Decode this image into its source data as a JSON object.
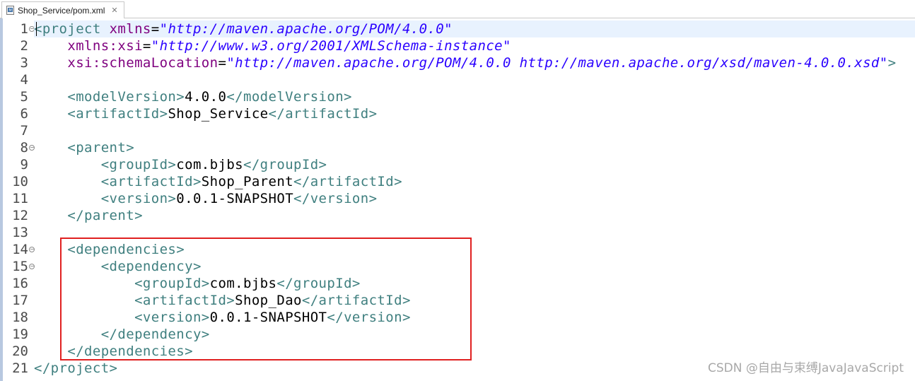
{
  "tab": {
    "title": "Shop_Service/pom.xml",
    "icon": "xml-file-icon",
    "close": "✕"
  },
  "lines": [
    {
      "n": "1",
      "fold": true,
      "parts": [
        [
          "tag",
          "<project "
        ],
        [
          "attr",
          "xmlns"
        ],
        [
          "eq",
          "="
        ],
        [
          "str",
          "\"http://maven.apache.org/POM/4.0.0\""
        ]
      ]
    },
    {
      "n": "2",
      "fold": false,
      "parts": [
        [
          "txt",
          "    "
        ],
        [
          "attr",
          "xmlns:xsi"
        ],
        [
          "eq",
          "="
        ],
        [
          "str",
          "\"http://www.w3.org/2001/XMLSchema-instance\""
        ]
      ]
    },
    {
      "n": "3",
      "fold": false,
      "parts": [
        [
          "txt",
          "    "
        ],
        [
          "attr",
          "xsi:schemaLocation"
        ],
        [
          "eq",
          "="
        ],
        [
          "str",
          "\"http://maven.apache.org/POM/4.0.0 http://maven.apache.org/xsd/maven-4.0.0.xsd\""
        ],
        [
          "tag",
          ">"
        ]
      ]
    },
    {
      "n": "4",
      "fold": false,
      "parts": []
    },
    {
      "n": "5",
      "fold": false,
      "parts": [
        [
          "txt",
          "    "
        ],
        [
          "tag",
          "<modelVersion>"
        ],
        [
          "txt",
          "4.0.0"
        ],
        [
          "tag",
          "</modelVersion>"
        ]
      ]
    },
    {
      "n": "6",
      "fold": false,
      "parts": [
        [
          "txt",
          "    "
        ],
        [
          "tag",
          "<artifactId>"
        ],
        [
          "txt",
          "Shop_Service"
        ],
        [
          "tag",
          "</artifactId>"
        ]
      ]
    },
    {
      "n": "7",
      "fold": false,
      "parts": []
    },
    {
      "n": "8",
      "fold": true,
      "parts": [
        [
          "txt",
          "    "
        ],
        [
          "tag",
          "<parent>"
        ]
      ]
    },
    {
      "n": "9",
      "fold": false,
      "parts": [
        [
          "txt",
          "        "
        ],
        [
          "tag",
          "<groupId>"
        ],
        [
          "txt",
          "com.bjbs"
        ],
        [
          "tag",
          "</groupId>"
        ]
      ]
    },
    {
      "n": "10",
      "fold": false,
      "parts": [
        [
          "txt",
          "        "
        ],
        [
          "tag",
          "<artifactId>"
        ],
        [
          "txt",
          "Shop_Parent"
        ],
        [
          "tag",
          "</artifactId>"
        ]
      ]
    },
    {
      "n": "11",
      "fold": false,
      "parts": [
        [
          "txt",
          "        "
        ],
        [
          "tag",
          "<version>"
        ],
        [
          "txt",
          "0.0.1-SNAPSHOT"
        ],
        [
          "tag",
          "</version>"
        ]
      ]
    },
    {
      "n": "12",
      "fold": false,
      "parts": [
        [
          "txt",
          "    "
        ],
        [
          "tag",
          "</parent>"
        ]
      ]
    },
    {
      "n": "13",
      "fold": false,
      "parts": []
    },
    {
      "n": "14",
      "fold": true,
      "parts": [
        [
          "txt",
          "    "
        ],
        [
          "tag",
          "<dependencies>"
        ]
      ]
    },
    {
      "n": "15",
      "fold": true,
      "parts": [
        [
          "txt",
          "        "
        ],
        [
          "tag",
          "<dependency>"
        ]
      ]
    },
    {
      "n": "16",
      "fold": false,
      "parts": [
        [
          "txt",
          "            "
        ],
        [
          "tag",
          "<groupId>"
        ],
        [
          "txt",
          "com.bjbs"
        ],
        [
          "tag",
          "</groupId>"
        ]
      ]
    },
    {
      "n": "17",
      "fold": false,
      "parts": [
        [
          "txt",
          "            "
        ],
        [
          "tag",
          "<artifactId>"
        ],
        [
          "txt",
          "Shop_Dao"
        ],
        [
          "tag",
          "</artifactId>"
        ]
      ]
    },
    {
      "n": "18",
      "fold": false,
      "parts": [
        [
          "txt",
          "            "
        ],
        [
          "tag",
          "<version>"
        ],
        [
          "txt",
          "0.0.1-SNAPSHOT"
        ],
        [
          "tag",
          "</version>"
        ]
      ]
    },
    {
      "n": "19",
      "fold": false,
      "parts": [
        [
          "txt",
          "        "
        ],
        [
          "tag",
          "</dependency>"
        ]
      ]
    },
    {
      "n": "20",
      "fold": false,
      "parts": [
        [
          "txt",
          "    "
        ],
        [
          "tag",
          "</dependencies>"
        ]
      ]
    },
    {
      "n": "21",
      "fold": false,
      "parts": [
        [
          "tag",
          "</project>"
        ]
      ]
    }
  ],
  "watermark": "CSDN @自由与束缚JavaJavaScript",
  "colors": {
    "tag": "#3f7f7f",
    "attribute": "#7f007f",
    "string": "#2a00ff",
    "highlight_box": "#e02020"
  }
}
